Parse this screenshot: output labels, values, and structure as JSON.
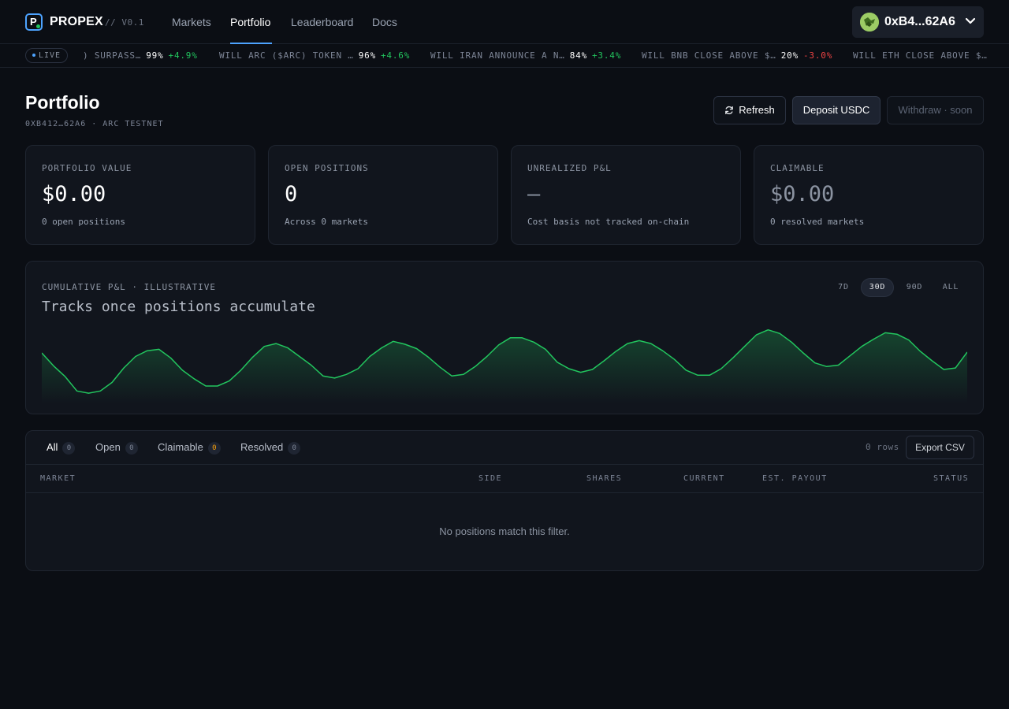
{
  "nav": {
    "brand": "PROPEX",
    "version": "// V0.1",
    "links": [
      "Markets",
      "Portfolio",
      "Leaderboard",
      "Docs"
    ],
    "active_link": "Portfolio",
    "wallet": "0xB4...62A6"
  },
  "ticker": {
    "live_label": "LIVE",
    "items": [
      {
        "text": ") SURPASS…",
        "pct": "99%",
        "change": "+4.9%"
      },
      {
        "text": "WILL ARC ($ARC) TOKEN …",
        "pct": "96%",
        "change": "+4.6%"
      },
      {
        "text": "WILL IRAN ANNOUNCE A N…",
        "pct": "84%",
        "change": "+3.4%"
      },
      {
        "text": "WILL BNB CLOSE ABOVE $…",
        "pct": "20%",
        "change": "-3.0%"
      },
      {
        "text": "WILL ETH CLOSE ABOVE $…",
        "pct": "",
        "change": ""
      }
    ]
  },
  "header": {
    "title": "Portfolio",
    "subtitle": "0XB412…62A6 · ARC TESTNET",
    "refresh_label": "Refresh",
    "deposit_label": "Deposit USDC",
    "withdraw_label": "Withdraw · soon"
  },
  "stats": [
    {
      "label": "PORTFOLIO VALUE",
      "value": "$0.00",
      "note": "0 open positions"
    },
    {
      "label": "OPEN POSITIONS",
      "value": "0",
      "note": "Across 0 markets"
    },
    {
      "label": "UNREALIZED P&L",
      "value": "—",
      "note": "Cost basis not tracked on-chain"
    },
    {
      "label": "CLAIMABLE",
      "value": "$0.00",
      "note": "0 resolved markets"
    }
  ],
  "pnl": {
    "label": "CUMULATIVE P&L · ILLUSTRATIVE",
    "title": "Tracks once positions accumulate",
    "ranges": [
      "7D",
      "30D",
      "90D",
      "ALL"
    ],
    "active_range": "30D",
    "line_color": "#22c55e"
  },
  "chart_data": {
    "type": "area",
    "title": "",
    "xlabel": "",
    "ylabel": "",
    "grid": false,
    "values": [
      55,
      37,
      22,
      2,
      -1,
      2,
      14,
      34,
      50,
      58,
      60,
      48,
      31,
      19,
      9,
      9,
      16,
      31,
      49,
      64,
      68,
      62,
      50,
      38,
      23,
      20,
      25,
      33,
      50,
      62,
      71,
      67,
      61,
      49,
      35,
      23,
      25,
      36,
      50,
      66,
      76,
      76,
      70,
      60,
      42,
      33,
      28,
      32,
      44,
      57,
      68,
      72,
      68,
      58,
      46,
      31,
      24,
      24,
      33,
      48,
      64,
      80,
      87,
      82,
      70,
      55,
      41,
      36,
      38,
      51,
      64,
      74,
      83,
      81,
      73,
      57,
      44,
      32,
      34,
      56
    ]
  },
  "positions": {
    "tabs": [
      {
        "label": "All",
        "count": "0"
      },
      {
        "label": "Open",
        "count": "0"
      },
      {
        "label": "Claimable",
        "count": "0"
      },
      {
        "label": "Resolved",
        "count": "0"
      }
    ],
    "active_tab": "All",
    "rows_label": "0 rows",
    "export_label": "Export CSV",
    "columns": [
      "MARKET",
      "SIDE",
      "SHARES",
      "CURRENT",
      "EST. PAYOUT",
      "STATUS"
    ],
    "empty_message": "No positions match this filter."
  }
}
